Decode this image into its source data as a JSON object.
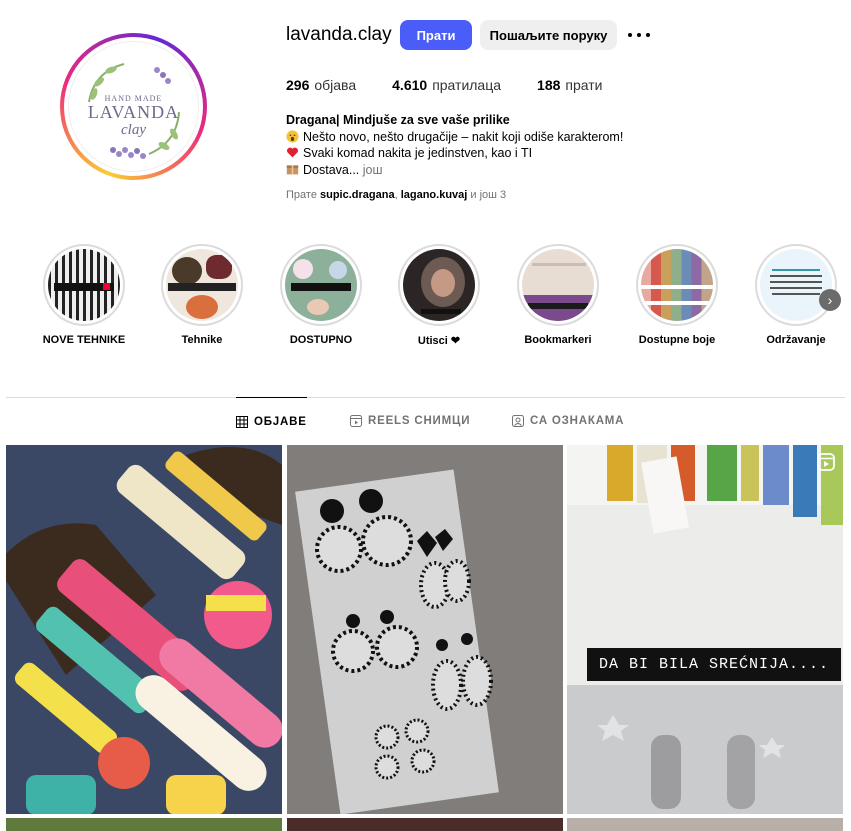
{
  "profile": {
    "username": "lavanda.clay",
    "follow_label": "Прати",
    "message_label": "Пошаљите поруку",
    "logo": {
      "top": "HAND MADE",
      "main": "LAVANDA",
      "sub": "clay"
    }
  },
  "stats": {
    "posts": {
      "value": "296",
      "label": "објава"
    },
    "followers": {
      "value": "4.610",
      "label": "пратилаца"
    },
    "following": {
      "value": "188",
      "label": "прати"
    }
  },
  "bio": {
    "name": "Dragana| Mindjuše za sve vaše prilike",
    "line1": "Nešto novo, nešto drugačije – nakit koji odiše karakterom!",
    "line2": "Svaki komad nakita je jedinstven, kao i TI",
    "line3": "Dostava...",
    "more": "још",
    "followed_prefix": "Прате",
    "followed_user1": "supic.dragana",
    "followed_user2": "lagano.kuvaj",
    "followed_suffix": "и још 3"
  },
  "highlights": [
    {
      "label": "NOVE TEHNIKE"
    },
    {
      "label": "Tehnike"
    },
    {
      "label": "DOSTUPNO"
    },
    {
      "label": "Utisci ❤"
    },
    {
      "label": "Bookmarkeri"
    },
    {
      "label": "Dostupne boje"
    },
    {
      "label": "Održavanje"
    }
  ],
  "tabs": {
    "posts": "ОБЈАВЕ",
    "reels": "REELS СНИМЦИ",
    "tagged": "СА ОЗНАКАМА"
  },
  "posts": {
    "caption3": "DA BI BILA SREĆNIJA...."
  },
  "colors": {
    "accent": "#4a5df9",
    "message_bg": "#efefef",
    "muted": "#737373"
  }
}
